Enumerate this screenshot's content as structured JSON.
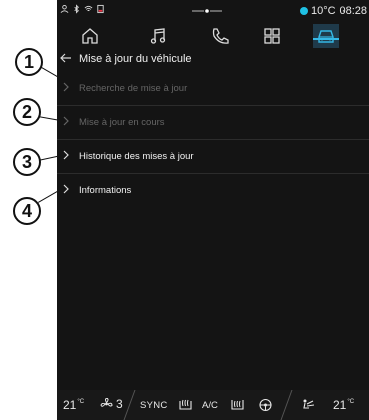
{
  "status_bar": {
    "temperature": "10°C",
    "separator": "·",
    "time": "08:28"
  },
  "nav": {
    "icons": [
      "home-icon",
      "music-icon",
      "phone-icon",
      "apps-icon",
      "car-icon"
    ],
    "active": "car-icon"
  },
  "header": {
    "back_icon": "back-arrow-icon",
    "title": "Mise à jour du véhicule"
  },
  "menu": {
    "items": [
      {
        "label": "Recherche de mise à jour",
        "enabled": false
      },
      {
        "label": "Mise à jour en cours",
        "enabled": false
      },
      {
        "label": "Historique des mises à jour",
        "enabled": true
      },
      {
        "label": "Informations",
        "enabled": true
      }
    ]
  },
  "callouts": [
    "1",
    "2",
    "3",
    "4"
  ],
  "climate": {
    "left_temp": "21",
    "left_unit": "°C",
    "fan_speed": "3",
    "sync_label": "SYNC",
    "ac_label": "A/C",
    "right_temp": "21",
    "right_unit": "°C"
  },
  "colors": {
    "accent": "#35b8e6",
    "background": "#141414",
    "disabled_text": "#656565"
  }
}
